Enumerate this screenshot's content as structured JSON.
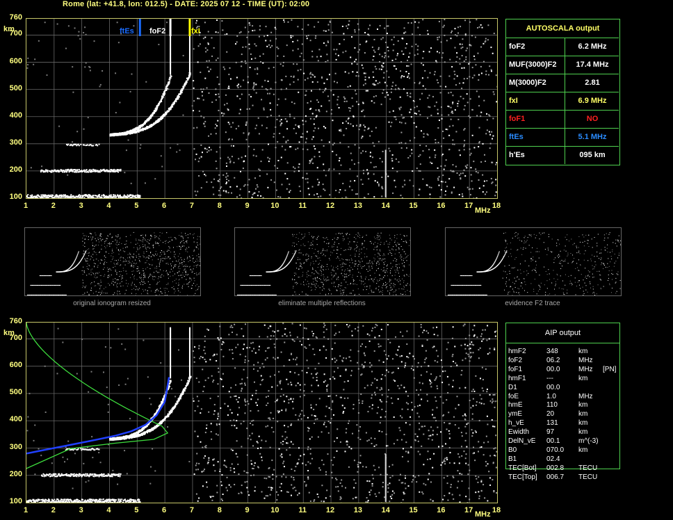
{
  "header": "Rome (lat: +41.8, lon: 012.5) - DATE: 2025 07 12 - TIME (UT): 02:00",
  "axes": {
    "y_ticks": [
      "760",
      "700",
      "600",
      "500",
      "400",
      "300",
      "200",
      "100"
    ],
    "y_unit": "km",
    "x_ticks": [
      "1",
      "2",
      "3",
      "4",
      "5",
      "6",
      "7",
      "8",
      "9",
      "10",
      "11",
      "12",
      "13",
      "14",
      "15",
      "16",
      "17",
      "18"
    ],
    "x_unit": "MHz"
  },
  "markers": {
    "ftEs": {
      "label": "ftEs",
      "freq": 5.1,
      "color": "#1a6cff"
    },
    "foF2": {
      "label": "foF2",
      "freq": 6.2,
      "color": "#ffffff"
    },
    "fxI": {
      "label": "fxI",
      "freq": 6.9,
      "color": "#ffff00"
    }
  },
  "autoscala": {
    "title": "AUTOSCALA output",
    "rows": [
      {
        "key": "foF2",
        "value": "6.2 MHz",
        "color": "#ffffff"
      },
      {
        "key": "MUF(3000)F2",
        "value": "17.4 MHz",
        "color": "#ffffff"
      },
      {
        "key": "M(3000)F2",
        "value": "2.81",
        "color": "#ffffff"
      },
      {
        "key": "fxI",
        "value": "6.9 MHz",
        "color": "#ffff66"
      },
      {
        "key": "foF1",
        "value": "NO",
        "color": "#ff2020"
      },
      {
        "key": "ftEs",
        "value": "5.1 MHz",
        "color": "#2a8cff"
      },
      {
        "key": "h'Es",
        "value": "095   km",
        "color": "#ffffff"
      }
    ]
  },
  "thumbnails": [
    {
      "caption": "original ionogram resized"
    },
    {
      "caption": "eliminate multiple reflections"
    },
    {
      "caption": "evidence F2 trace"
    }
  ],
  "aip": {
    "title": "AIP output",
    "rows": [
      [
        "hmF2",
        "348",
        "km",
        ""
      ],
      [
        "foF2",
        "06.2",
        "MHz",
        ""
      ],
      [
        "foF1",
        "00.0",
        "MHz",
        "[PN]"
      ],
      [
        "hmF1",
        "---",
        "km",
        ""
      ],
      [
        "D1",
        "00.0",
        "",
        ""
      ],
      [
        "foE",
        "1.0",
        "MHz",
        ""
      ],
      [
        "hmE",
        "110",
        "km",
        ""
      ],
      [
        "ymE",
        "20",
        "km",
        ""
      ],
      [
        "h_vE",
        "131",
        "km",
        ""
      ],
      [
        "Ewidth",
        "97",
        "km",
        ""
      ],
      [
        "DelN_vE",
        "00.1",
        "m^(-3)",
        ""
      ],
      [
        "B0",
        "070.0",
        "km",
        ""
      ],
      [
        "B1",
        "02.4",
        "",
        ""
      ],
      [
        "TEC[Bot]",
        "002.8",
        "TECU",
        ""
      ],
      [
        "TEC[Top]",
        "006.7",
        "TECU",
        ""
      ]
    ]
  }
}
